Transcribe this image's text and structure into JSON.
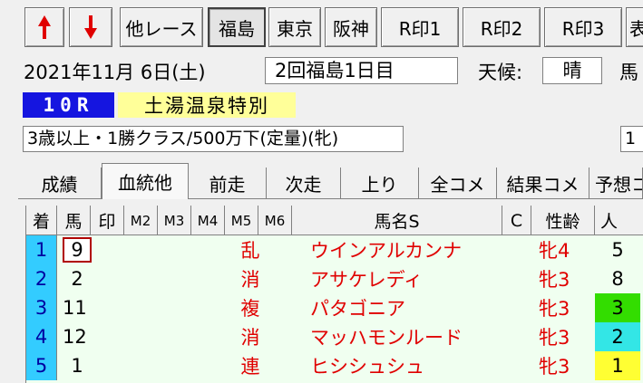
{
  "toolbar": {
    "up_label": "▲",
    "down_label": "▼",
    "other_race": "他レース",
    "venues": [
      "福島",
      "東京",
      "阪神"
    ],
    "marks": [
      "R印1",
      "R印2",
      "R印3"
    ],
    "extra": "表"
  },
  "race_info": {
    "date": "2021年11月 6日(土)",
    "meeting": "2回福島1日目",
    "weather_label": "天候:",
    "weather": "晴",
    "track_label": "馬",
    "race_no": "10R",
    "race_name": "土湯温泉特別",
    "conditions": "3歳以上・1勝クラス/500万下(定量)(牝)",
    "conditions_right": "1"
  },
  "tabs": [
    "成績",
    "血統他",
    "前走",
    "次走",
    "上り",
    "全コメ",
    "結果コメ",
    "予想コ"
  ],
  "table": {
    "headers": [
      "着",
      "馬",
      "印",
      "M2",
      "M3",
      "M4",
      "M5",
      "M6",
      "馬名S",
      "C",
      "性齢",
      "人"
    ],
    "rows": [
      {
        "rank": "1",
        "num": "9",
        "m5": "乱",
        "name": "ウインアルカンナ",
        "sex_age": "牝4",
        "pop": "5"
      },
      {
        "rank": "2",
        "num": "2",
        "m5": "消",
        "name": "アサケレディ",
        "sex_age": "牝3",
        "pop": "8"
      },
      {
        "rank": "3",
        "num": "11",
        "m5": "複",
        "name": "パタゴニア",
        "sex_age": "牝3",
        "pop": "3"
      },
      {
        "rank": "4",
        "num": "12",
        "m5": "消",
        "name": "マッハモンルード",
        "sex_age": "牝3",
        "pop": "2"
      },
      {
        "rank": "5",
        "num": "1",
        "m5": "連",
        "name": "ヒシシュシュ",
        "sex_age": "牝3",
        "pop": "1"
      }
    ]
  },
  "colors": {
    "rank_bg": "#33ccff",
    "race_no_bg": "#1515e0",
    "race_name_bg": "#ffff99",
    "pop_green": "#33dd00",
    "pop_cyan": "#33e6e6",
    "pop_yellow": "#ffff33"
  }
}
